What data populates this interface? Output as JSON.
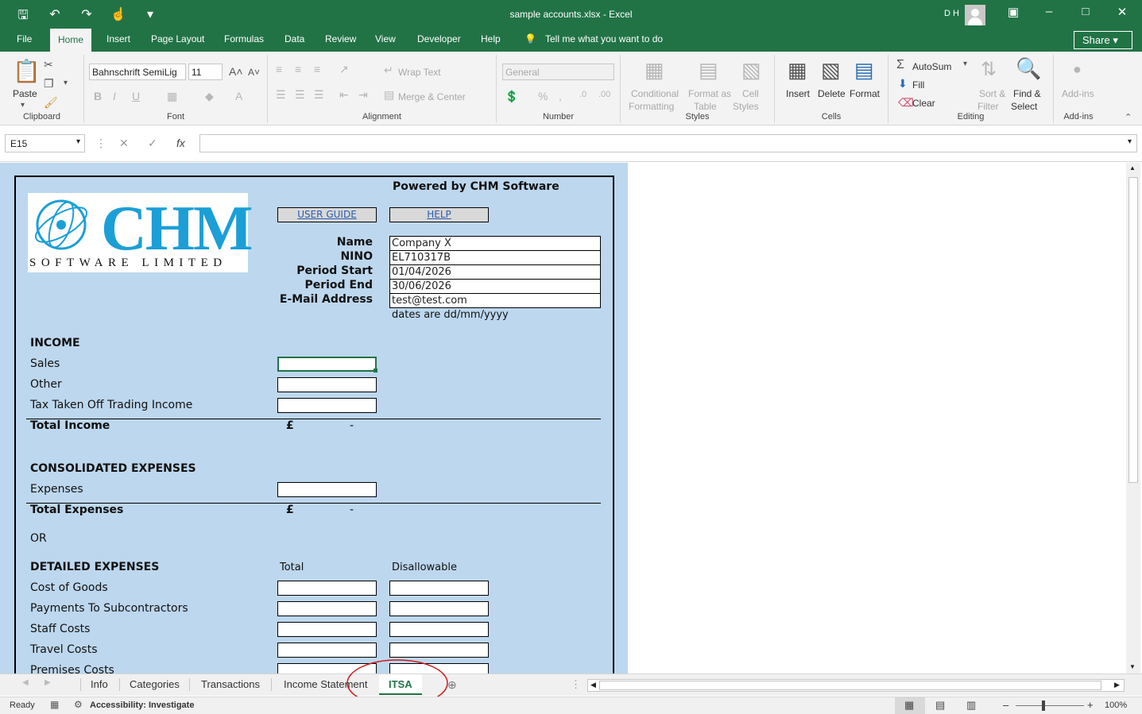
{
  "window": {
    "title": "sample accounts.xlsx  -  Excel",
    "user_initials": "D H",
    "share_label": "Share"
  },
  "ribbon_tabs": [
    "File",
    "Home",
    "Insert",
    "Page Layout",
    "Formulas",
    "Data",
    "Review",
    "View",
    "Developer",
    "Help"
  ],
  "tell_me": "Tell me what you want to do",
  "ribbon": {
    "clipboard": {
      "paste": "Paste",
      "label": "Clipboard"
    },
    "font": {
      "name": "Bahnschrift SemiLig",
      "size": "11",
      "label": "Font"
    },
    "alignment": {
      "wrap": "Wrap Text",
      "merge": "Merge & Center",
      "label": "Alignment"
    },
    "number": {
      "format": "General",
      "label": "Number"
    },
    "styles": {
      "conditional": "Conditional",
      "formatting": "Formatting",
      "format_as": "Format as",
      "table": "Table",
      "cell": "Cell",
      "styles_word": "Styles",
      "label": "Styles"
    },
    "cells": {
      "insert": "Insert",
      "delete": "Delete",
      "format": "Format",
      "label": "Cells"
    },
    "editing": {
      "autosum": "AutoSum",
      "fill": "Fill",
      "clear": "Clear",
      "sort": "Sort &",
      "filter": "Filter",
      "find": "Find &",
      "select": "Select",
      "label": "Editing"
    },
    "addins": {
      "addins": "Add-ins",
      "label": "Add-ins"
    }
  },
  "formula_bar": {
    "name_box": "E15",
    "formula": ""
  },
  "form": {
    "powered_by": "Powered by CHM Software",
    "logo_text": "CHM",
    "logo_sub": "SOFTWARE LIMITED",
    "user_guide": "USER GUIDE",
    "help": "HELP",
    "details": [
      {
        "label": "Name",
        "value": "Company X"
      },
      {
        "label": "NINO",
        "value": "EL710317B"
      },
      {
        "label": "Period Start",
        "value": "01/04/2026"
      },
      {
        "label": "Period End",
        "value": "30/06/2026"
      },
      {
        "label": "E-Mail Address",
        "value": "test@test.com"
      }
    ],
    "date_note": "dates are dd/mm/yyyy",
    "income_heading": "INCOME",
    "income_rows": [
      "Sales",
      "Other",
      "Tax Taken Off Trading Income"
    ],
    "total_income": "Total Income",
    "currency": "£",
    "dash": "-",
    "consolidated_heading": "CONSOLIDATED EXPENSES",
    "expenses_label": "Expenses",
    "total_expenses": "Total Expenses",
    "or_label": "OR",
    "detailed_heading": "DETAILED EXPENSES",
    "col_total": "Total",
    "col_disallowable": "Disallowable",
    "detailed_rows": [
      "Cost of Goods",
      "Payments To Subcontractors",
      "Staff Costs",
      "Travel Costs",
      "Premises Costs"
    ]
  },
  "sheet_tabs": [
    "Info",
    "Categories",
    "Transactions",
    "Income Statement",
    "ITSA"
  ],
  "active_sheet": "ITSA",
  "status": {
    "ready": "Ready",
    "accessibility": "Accessibility: Investigate",
    "zoom": "100%"
  },
  "colors": {
    "excel_green": "#217346",
    "sheet_blue": "#bdd7ee",
    "annotation_red": "#d01818",
    "logo_blue": "#1b9fd6"
  }
}
